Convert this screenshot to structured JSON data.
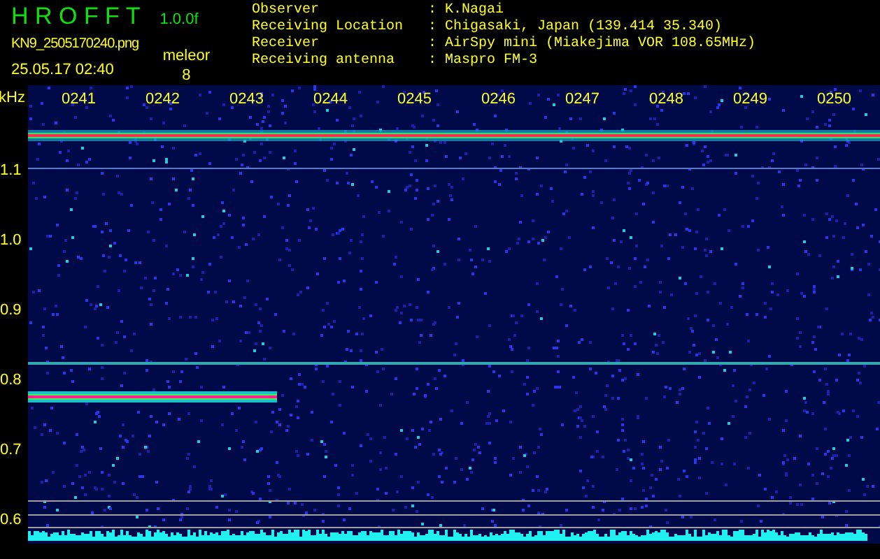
{
  "header": {
    "title": "H R O F F T",
    "version": "1.0.0f",
    "filename": "KN9_2505170240.png",
    "mode": "meleor",
    "date_time": "25.05.17 02:40",
    "count": "8"
  },
  "info": [
    {
      "label": "Observer",
      "separator": ":",
      "value": "K.Nagai"
    },
    {
      "label": "Receiving Location",
      "separator": ":",
      "value": "Chigasaki, Japan (139.414 35.340)"
    },
    {
      "label": "Receiver",
      "separator": ":",
      "value": "AirSpy mini (Miakejima VOR 108.65MHz)"
    },
    {
      "label": "Receiving antenna",
      "separator": ":",
      "value": "Maspro FM-3"
    }
  ],
  "y_axis": {
    "unit": "kHz",
    "ticks": [
      "1.1",
      "1.0",
      "0.9",
      "0.8",
      "0.7",
      "0.6"
    ]
  },
  "time_labels": [
    "0241",
    "0242",
    "0243",
    "0244",
    "0245",
    "0246",
    "0247",
    "0248",
    "0249",
    "0250"
  ]
}
